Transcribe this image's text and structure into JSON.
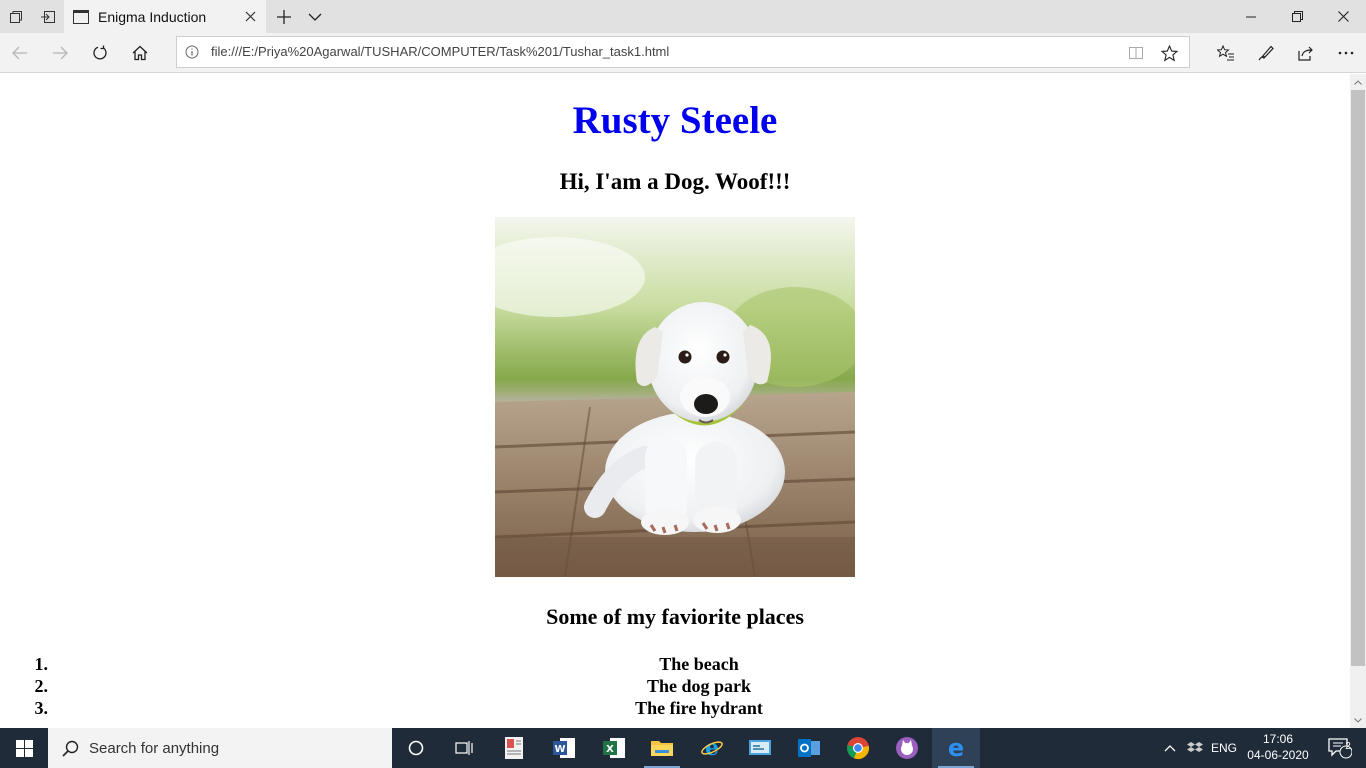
{
  "browser": {
    "tab_title": "Enigma Induction",
    "url": "file:///E:/Priya%20Agarwal/TUSHAR/COMPUTER/Task%201/Tushar_task1.html"
  },
  "page": {
    "title": "Rusty Steele",
    "subtitle": "Hi, I'am a Dog. Woof!!!",
    "places_heading": "Some of my faviorite places",
    "places": [
      {
        "num": "1.",
        "label": "The beach"
      },
      {
        "num": "2.",
        "label": "The dog park"
      },
      {
        "num": "3.",
        "label": "The fire hydrant"
      }
    ],
    "title_color": "#0000ee"
  },
  "taskbar": {
    "search_placeholder": "Search for anything",
    "language": "ENG",
    "time": "17:06",
    "date": "04-06-2020",
    "notification_count": "2",
    "apps": [
      "task-view-icon",
      "file-icon",
      "word-icon",
      "excel-icon",
      "file-explorer-icon",
      "internet-explorer-icon",
      "outlook-icon",
      "chrome-icon",
      "app-icon",
      "edge-icon"
    ]
  }
}
